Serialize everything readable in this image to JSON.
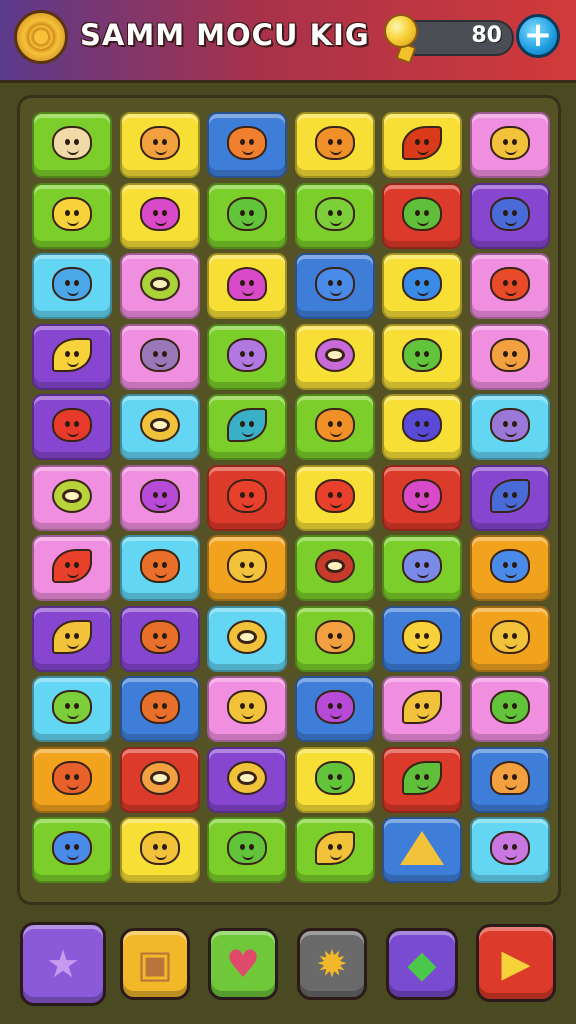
{
  "header": {
    "title": "SAMM MOCU KIG",
    "coins": "80",
    "coin_icon": "coin-icon",
    "plus_label": "+",
    "colors": {
      "left": "#5a3a8c",
      "right": "#d23a3a"
    }
  },
  "board": {
    "rows": 11,
    "cols": 6,
    "palette": {
      "G": "#7ccf2a",
      "Y": "#f7df36",
      "B": "#3f7ed8",
      "U": "#8646d0",
      "P": "#f08ee0",
      "C": "#62d6f2",
      "R": "#dc3a2a",
      "O": "#f2a31e"
    },
    "tiles": [
      [
        "G",
        "Y",
        "B",
        "Y",
        "Y",
        "P"
      ],
      [
        "G",
        "Y",
        "G",
        "G",
        "R",
        "U"
      ],
      [
        "C",
        "P",
        "Y",
        "B",
        "Y",
        "P"
      ],
      [
        "U",
        "P",
        "G",
        "Y",
        "Y",
        "P"
      ],
      [
        "U",
        "C",
        "G",
        "G",
        "Y",
        "C"
      ],
      [
        "P",
        "P",
        "R",
        "Y",
        "R",
        "U"
      ],
      [
        "P",
        "C",
        "O",
        "G",
        "G",
        "O"
      ],
      [
        "U",
        "U",
        "C",
        "G",
        "B",
        "O"
      ],
      [
        "C",
        "B",
        "P",
        "B",
        "P",
        "P"
      ],
      [
        "O",
        "R",
        "U",
        "Y",
        "R",
        "B"
      ],
      [
        "G",
        "Y",
        "G",
        "G",
        "B",
        "C"
      ]
    ],
    "icon_colors": [
      [
        "#f2d9a8",
        "#f2a040",
        "#f08030",
        "#f09028",
        "#d83a1a",
        "#f2c23a"
      ],
      [
        "#f7d23a",
        "#d84ac8",
        "#62c43a",
        "#7ccf3a",
        "#5fbf3a",
        "#4a6ad8"
      ],
      [
        "#4aa8e8",
        "#a8d43a",
        "#d84ac8",
        "#4a8ae8",
        "#3a8ae8",
        "#e84a2a"
      ],
      [
        "#f7d23a",
        "#9a78b8",
        "#b078e0",
        "#c86ad8",
        "#62c43a",
        "#f2a040"
      ],
      [
        "#e83a2a",
        "#f2c23a",
        "#3ab0c8",
        "#f09028",
        "#5a4ad8",
        "#9a78d8"
      ],
      [
        "#b8d43a",
        "#b84ad8",
        "#e8402a",
        "#e8402a",
        "#d84ac8",
        "#4a6ad8"
      ],
      [
        "#e8402a",
        "#e8702a",
        "#f2c23a",
        "#c83a2a",
        "#7a8ae8",
        "#4a8ae8"
      ],
      [
        "#f2c23a",
        "#e8702a",
        "#f2c23a",
        "#f2a040",
        "#f7d23a",
        "#f2c23a"
      ],
      [
        "#7ccf3a",
        "#e8702a",
        "#f2c23a",
        "#b84ad8",
        "#f2c23a",
        "#62c43a"
      ],
      [
        "#e8602a",
        "#f2a040",
        "#f2c23a",
        "#62c43a",
        "#5fbf3a",
        "#f2a040"
      ],
      [
        "#4a8ae8",
        "#f2c23a",
        "#62c43a",
        "#f2c23a",
        "#f2c23a",
        "#c878e0"
      ]
    ],
    "icon_shapes": [
      [
        "blob",
        "blob",
        "blob",
        "blob",
        "leaf",
        "blob"
      ],
      [
        "blob",
        "blob",
        "blob",
        "blob",
        "blob",
        "blob"
      ],
      [
        "blob",
        "ring",
        "heart",
        "blob",
        "blob",
        "blob"
      ],
      [
        "leaf",
        "blob",
        "blob",
        "ring",
        "blob",
        "blob"
      ],
      [
        "blob",
        "ring",
        "leaf",
        "blob",
        "blob",
        "blob"
      ],
      [
        "ring",
        "blob",
        "blob",
        "blob",
        "blob",
        "leaf"
      ],
      [
        "leaf",
        "blob",
        "blob",
        "ring",
        "blob",
        "blob"
      ],
      [
        "leaf",
        "blob",
        "ring",
        "blob",
        "blob",
        "blob"
      ],
      [
        "blob",
        "blob",
        "blob",
        "blob",
        "leaf",
        "blob"
      ],
      [
        "blob",
        "ring",
        "ring",
        "blob",
        "leaf",
        "heart"
      ],
      [
        "blob",
        "blob",
        "blob",
        "leaf",
        "triangle",
        "blob"
      ]
    ]
  },
  "bottom_bar": {
    "buttons": [
      {
        "name": "star-button",
        "icon": "star-icon",
        "glyph": "★",
        "color": "#8a5ad8",
        "glyph_color": "#c79af0"
      },
      {
        "name": "box-button",
        "icon": "box-icon",
        "glyph": "▣",
        "color": "#f2b82a",
        "glyph_color": "#b8743a"
      },
      {
        "name": "heart-button",
        "icon": "heart-icon",
        "glyph": "♥",
        "color": "#6ec83a",
        "glyph_color": "#e04a6a"
      },
      {
        "name": "sun-button",
        "icon": "sun-icon",
        "glyph": "✹",
        "color": "#6a6a6a",
        "glyph_color": "#f2b82a"
      },
      {
        "name": "gem-button",
        "icon": "gem-icon",
        "glyph": "◆",
        "color": "#7a4ad0",
        "glyph_color": "#4ac84a"
      },
      {
        "name": "play-button",
        "icon": "play-icon",
        "glyph": "▶",
        "color": "#dc3a2a",
        "glyph_color": "#f7d23a"
      }
    ]
  }
}
